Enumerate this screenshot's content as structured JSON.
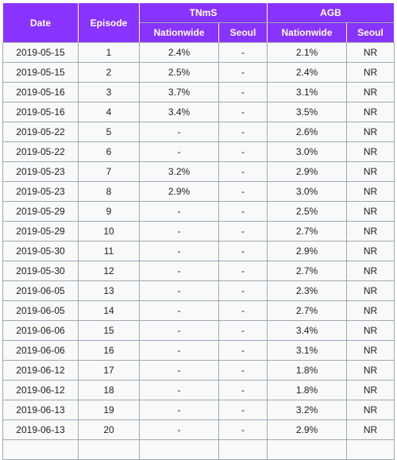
{
  "colors": {
    "header_bg": "#8833ff",
    "header_text": "#ffffff",
    "cell_bg": "#f9f9f9",
    "border": "#a2a9b1"
  },
  "table": {
    "headers": {
      "date": "Date",
      "episode": "Episode",
      "tnms": "TNmS",
      "agb": "AGB",
      "tnms_nationwide": "Nationwide",
      "tnms_seoul": "Seoul",
      "agb_nationwide": "Nationwide",
      "agb_seoul": "Seoul"
    },
    "rows": [
      [
        "2019-05-15",
        "1",
        "2.4%",
        "-",
        "2.1%",
        "NR"
      ],
      [
        "2019-05-15",
        "2",
        "2.5%",
        "-",
        "2.4%",
        "NR"
      ],
      [
        "2019-05-16",
        "3",
        "3.7%",
        "-",
        "3.1%",
        "NR"
      ],
      [
        "2019-05-16",
        "4",
        "3.4%",
        "-",
        "3.5%",
        "NR"
      ],
      [
        "2019-05-22",
        "5",
        "-",
        "-",
        "2.6%",
        "NR"
      ],
      [
        "2019-05-22",
        "6",
        "-",
        "-",
        "3.0%",
        "NR"
      ],
      [
        "2019-05-23",
        "7",
        "3.2%",
        "-",
        "2.9%",
        "NR"
      ],
      [
        "2019-05-23",
        "8",
        "2.9%",
        "-",
        "3.0%",
        "NR"
      ],
      [
        "2019-05-29",
        "9",
        "-",
        "-",
        "2.5%",
        "NR"
      ],
      [
        "2019-05-29",
        "10",
        "-",
        "-",
        "2.7%",
        "NR"
      ],
      [
        "2019-05-30",
        "11",
        "-",
        "-",
        "2.9%",
        "NR"
      ],
      [
        "2019-05-30",
        "12",
        "-",
        "-",
        "2.7%",
        "NR"
      ],
      [
        "2019-06-05",
        "13",
        "-",
        "-",
        "2.3%",
        "NR"
      ],
      [
        "2019-06-05",
        "14",
        "-",
        "-",
        "2.7%",
        "NR"
      ],
      [
        "2019-06-06",
        "15",
        "-",
        "-",
        "3.4%",
        "NR"
      ],
      [
        "2019-06-06",
        "16",
        "-",
        "-",
        "3.1%",
        "NR"
      ],
      [
        "2019-06-12",
        "17",
        "-",
        "-",
        "1.8%",
        "NR"
      ],
      [
        "2019-06-12",
        "18",
        "-",
        "-",
        "1.8%",
        "NR"
      ],
      [
        "2019-06-13",
        "19",
        "-",
        "-",
        "3.2%",
        "NR"
      ],
      [
        "2019-06-13",
        "20",
        "-",
        "-",
        "2.9%",
        "NR"
      ]
    ]
  }
}
